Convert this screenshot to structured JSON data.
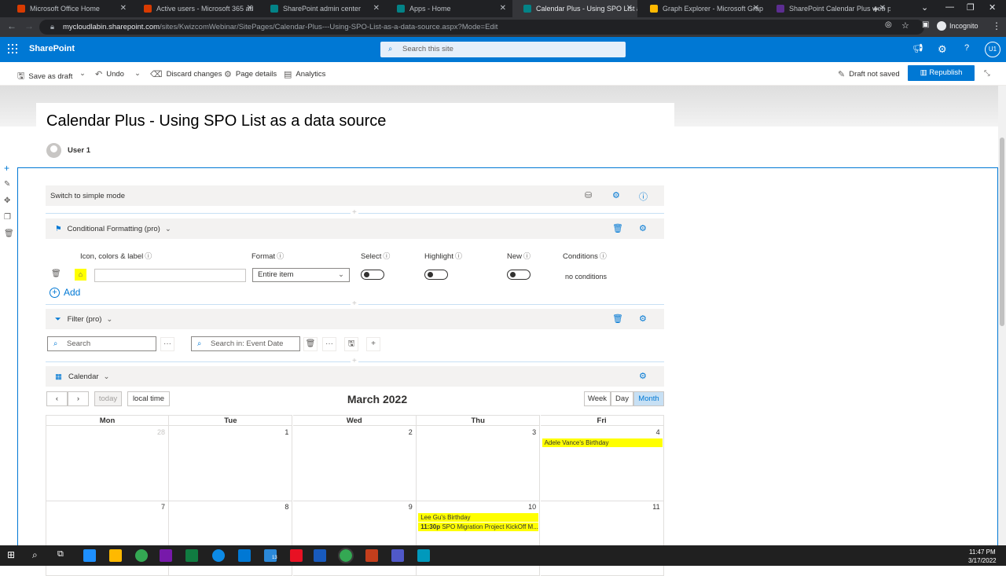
{
  "browser": {
    "tabs": [
      {
        "title": "Microsoft Office Home",
        "color": "#d83b01"
      },
      {
        "title": "Active users - Microsoft 365 ad",
        "color": "#d83b01"
      },
      {
        "title": "SharePoint admin center",
        "color": "#038387"
      },
      {
        "title": "Apps - Home",
        "color": "#038387"
      },
      {
        "title": "Calendar Plus - Using SPO List a",
        "color": "#038387",
        "active": true
      },
      {
        "title": "Graph Explorer - Microsoft Grap",
        "color": "#ffb900"
      },
      {
        "title": "SharePoint Calendar Plus web p",
        "color": "#5c2d91"
      }
    ],
    "url_host": "mycloudlabin.sharepoint.com",
    "url_path": "/sites/KwizcomWebinar/SitePages/Calendar-Plus---Using-SPO-List-as-a-data-source.aspx?Mode=Edit",
    "incognito_label": "Incognito"
  },
  "suite": {
    "brand": "SharePoint",
    "search_placeholder": "Search this site",
    "avatar_initials": "U1"
  },
  "commands": {
    "save_as_draft": "Save as draft",
    "undo": "Undo",
    "discard": "Discard changes",
    "page_details": "Page details",
    "analytics": "Analytics",
    "draft_status": "Draft not saved",
    "republish": "Republish"
  },
  "page": {
    "title": "Calendar Plus - Using SPO List as a data source",
    "author": "User 1"
  },
  "webpart": {
    "simple_mode": "Switch to simple mode",
    "conditional_formatting": "Conditional Formatting (pro)",
    "columns": {
      "icon_colors_label": "Icon, colors & label",
      "format": "Format",
      "select": "Select",
      "highlight": "Highlight",
      "new": "New",
      "conditions": "Conditions"
    },
    "format_value": "Entire item",
    "conditions_value": "no conditions",
    "add_label": "Add",
    "filter_title": "Filter (pro)",
    "search_placeholder": "Search",
    "search_in_placeholder": "Search in: Event Date",
    "calendar_title": "Calendar"
  },
  "calendar": {
    "today_label": "today",
    "local_time_label": "local time",
    "month_title": "March 2022",
    "views": [
      "Week",
      "Day",
      "Month"
    ],
    "active_view": "Month",
    "weekdays": [
      "Mon",
      "Tue",
      "Wed",
      "Thu",
      "Fri"
    ],
    "weeks": [
      [
        "28",
        "1",
        "2",
        "3",
        "4"
      ],
      [
        "7",
        "8",
        "9",
        "10",
        "11"
      ]
    ],
    "events": [
      {
        "week": 0,
        "day": 4,
        "row": 0,
        "text": "Adele Vance's Birthday"
      },
      {
        "week": 1,
        "day": 3,
        "row": 0,
        "text": "Lee Gu's Birthday"
      },
      {
        "week": 1,
        "day": 3,
        "row": 1,
        "time": "11:30p",
        "text": "SPO Migration Project KickOff M..."
      }
    ]
  },
  "taskbar": {
    "time": "11:47 PM",
    "date": "3/17/2022",
    "badge": "13"
  }
}
